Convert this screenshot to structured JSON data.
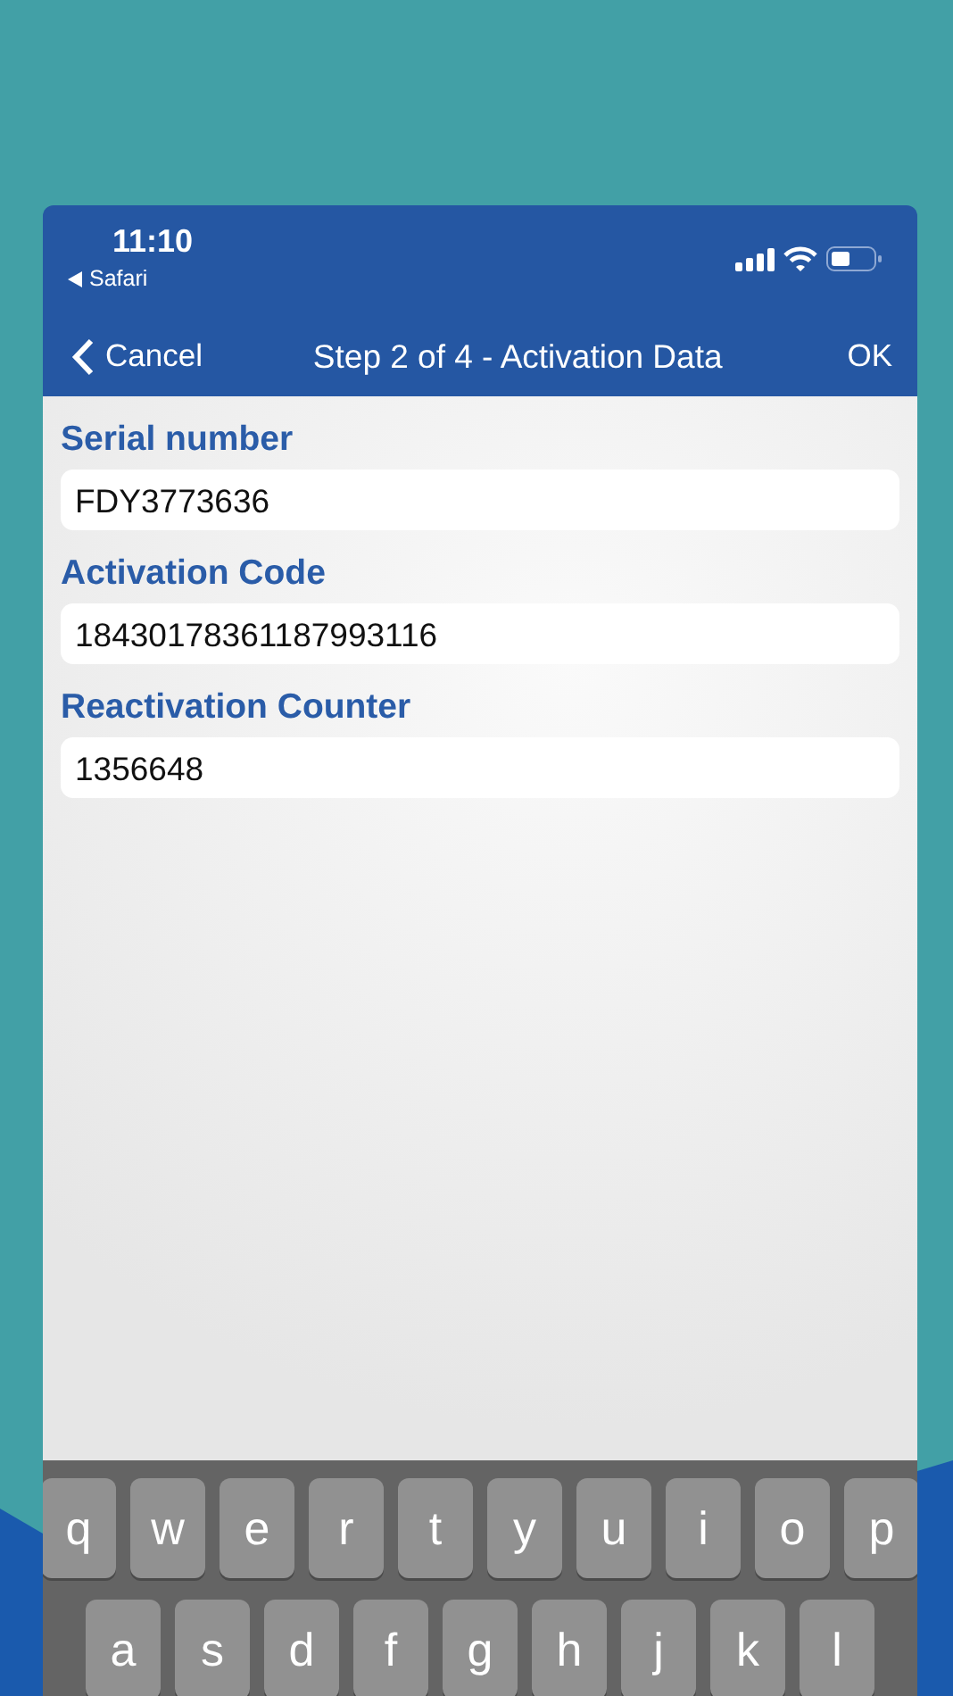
{
  "status_bar": {
    "time": "11:10",
    "back_app": "Safari"
  },
  "nav_bar": {
    "cancel": "Cancel",
    "title": "Step 2 of 4 - Activation Data",
    "ok": "OK"
  },
  "fields": [
    {
      "label": "Serial number",
      "value": "FDY3773636"
    },
    {
      "label": "Activation Code",
      "value": "18430178361187993116"
    },
    {
      "label": "Reactivation Counter",
      "value": "1356648"
    }
  ],
  "keyboard": {
    "rows": [
      [
        "q",
        "w",
        "e",
        "r",
        "t",
        "y",
        "u",
        "i",
        "o",
        "p"
      ],
      [
        "a",
        "s",
        "d",
        "f",
        "g",
        "h",
        "j",
        "k",
        "l"
      ]
    ]
  }
}
